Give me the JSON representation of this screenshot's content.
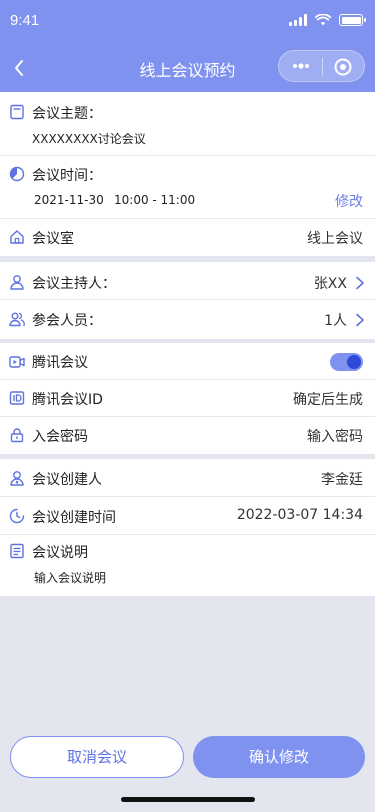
{
  "status_bar": {
    "time": "9:41"
  },
  "nav": {
    "title": "线上会议预约"
  },
  "topic": {
    "label": "会议主题：",
    "value": "XXXXXXXX讨论会议"
  },
  "time": {
    "label": "会议时间：",
    "date": "2021-11-30",
    "range": "10:00 - 11:00",
    "edit_link": "修改"
  },
  "room": {
    "label": "会议室",
    "value": "线上会议"
  },
  "host": {
    "label": "会议主持人：",
    "value": "张XX"
  },
  "participants": {
    "label": "参会人员：",
    "value": "1人"
  },
  "tencent": {
    "label": "腾讯会议",
    "enabled": true
  },
  "tencent_id": {
    "label": "腾讯会议ID",
    "value": "确定后生成"
  },
  "password": {
    "label": "入会密码",
    "value": "输入密码"
  },
  "creator": {
    "label": "会议创建人",
    "value": "李金廷"
  },
  "created_time": {
    "label": "会议创建时间",
    "value": "2022-03-07  14:34"
  },
  "description": {
    "label": "会议说明",
    "placeholder": "输入会议说明"
  },
  "buttons": {
    "cancel": "取消会议",
    "confirm": "确认修改"
  },
  "colors": {
    "accent": "#7f92ef",
    "accent_dark": "#2e4ad9",
    "background": "#e3e6ee"
  },
  "icons": [
    "back-icon",
    "more-icon",
    "target-icon",
    "document-icon",
    "clock-icon",
    "home-icon",
    "person-icon",
    "people-icon",
    "video-icon",
    "id-icon",
    "lock-icon",
    "creator-icon",
    "history-icon",
    "list-icon",
    "chevron-right-icon"
  ]
}
